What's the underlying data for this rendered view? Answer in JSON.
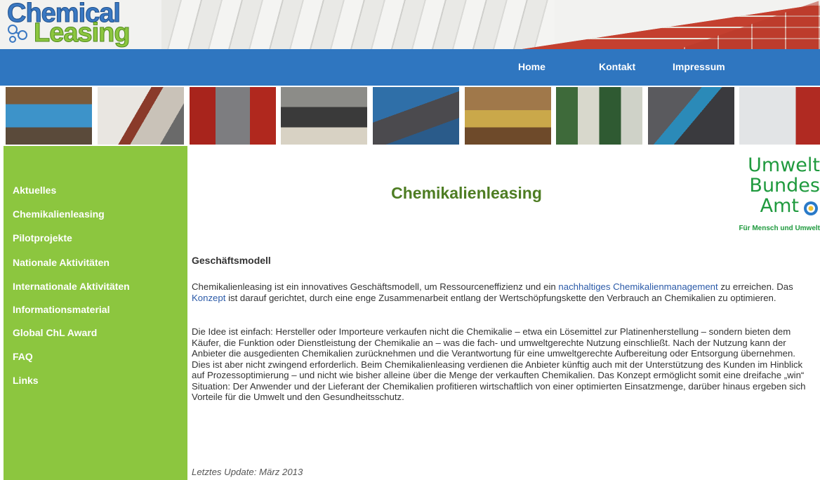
{
  "logo": {
    "line1": "Chemical",
    "line2": "Leasing"
  },
  "nav": {
    "home": "Home",
    "kontakt": "Kontakt",
    "impressum": "Impressum"
  },
  "sidebar": {
    "items": [
      {
        "label": "Aktuelles"
      },
      {
        "label": "Chemikalienleasing"
      },
      {
        "label": "Pilotprojekte"
      },
      {
        "label": "Nationale Aktivitäten"
      },
      {
        "label": "Internationale Aktivitäten"
      },
      {
        "label": "Informationsmaterial"
      },
      {
        "label": "Global ChL Award"
      },
      {
        "label": "FAQ"
      },
      {
        "label": "Links"
      }
    ]
  },
  "main": {
    "title": "Chemikalienleasing",
    "uba_logo": {
      "line1": "Umwelt",
      "line2": "Bundes",
      "line3": "Amt",
      "tagline": "Für Mensch und Umwelt"
    },
    "section_heading": "Geschäftsmodell",
    "p1": {
      "t1": "Chemikalienleasing ist ein innovatives Geschäftsmodell, um Ressourceneffizienz und ein ",
      "link1": "nachhaltiges Chemikalienmanagement",
      "t2": " zu erreichen. Das ",
      "link2": "Konzept",
      "t3": " ist darauf gerichtet, durch eine enge Zusammenarbeit entlang der Wertschöpfungskette den Verbrauch an Chemikalien zu optimieren."
    },
    "p2": "Die Idee ist einfach: Hersteller oder Importeure verkaufen nicht die Chemikalie – etwa ein Lösemittel zur Platinenherstellung – sondern bieten dem Käufer, die Funktion oder Dienstleistung der Chemikalie an – was die fach- und umweltgerechte Nutzung einschließt. Nach der Nutzung kann der Anbieter die ausgedienten Chemikalien zurücknehmen und die Verantwortung für eine umweltgerechte Aufbereitung oder Entsorgung übernehmen. Dies ist aber nicht zwingend erforderlich. Beim Chemikalienleasing verdienen die Anbieter künftig auch mit der Unterstützung des Kunden im Hinblick auf Prozessoptimierung – und nicht wie bisher alleine über die Menge der verkauften Chemikalien. Das Konzept ermöglicht somit eine dreifache „win“ Situation: Der Anwender und der Lieferant der Chemikalien profitieren wirtschaftlich von einer optimierten Einsatzmenge, darüber hinaus ergeben sich Vorteile für die Umwelt und den Gesundheitsschutz.",
    "last_update": "Letztes Update: März 2013"
  },
  "colors": {
    "nav_blue": "#2f76c0",
    "sidebar_green": "#8cc63f",
    "title_green": "#4e7d23",
    "link_blue": "#2b5aa8",
    "uba_green": "#1f9a3e"
  }
}
